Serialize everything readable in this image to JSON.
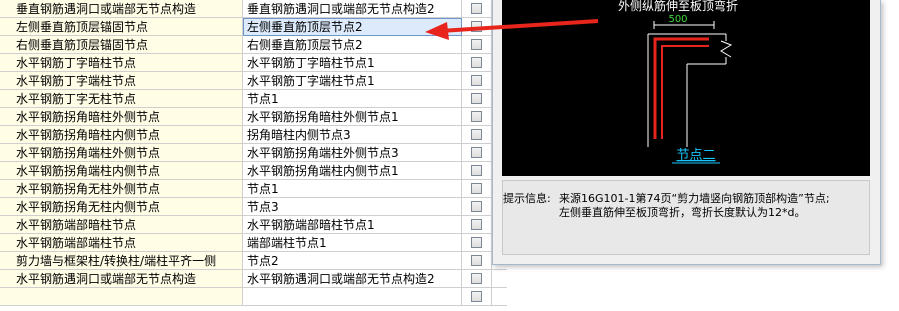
{
  "rows": [
    {
      "name": "垂直钢筋遇洞口或端部无节点构造",
      "value": "垂直钢筋遇洞口或端部无节点构造2"
    },
    {
      "name": "左侧垂直筋顶层锚固节点",
      "value": "左侧垂直筋顶层节点2"
    },
    {
      "name": "右侧垂直筋顶层锚固节点",
      "value": "右侧垂直筋顶层节点2"
    },
    {
      "name": "水平钢筋丁字暗柱节点",
      "value": "水平钢筋丁字暗柱节点1"
    },
    {
      "name": "水平钢筋丁字端柱节点",
      "value": "水平钢筋丁字端柱节点1"
    },
    {
      "name": "水平钢筋丁字无柱节点",
      "value": "节点1"
    },
    {
      "name": "水平钢筋拐角暗柱外侧节点",
      "value": "水平钢筋拐角暗柱外侧节点1"
    },
    {
      "name": "水平钢筋拐角暗柱内侧节点",
      "value": "拐角暗柱内侧节点3"
    },
    {
      "name": "水平钢筋拐角端柱外侧节点",
      "value": "水平钢筋拐角端柱外侧节点3"
    },
    {
      "name": "水平钢筋拐角端柱内侧节点",
      "value": "水平钢筋拐角端柱内侧节点1"
    },
    {
      "name": "水平钢筋拐角无柱外侧节点",
      "value": "节点1"
    },
    {
      "name": "水平钢筋拐角无柱内侧节点",
      "value": "节点3"
    },
    {
      "name": "水平钢筋端部暗柱节点",
      "value": "水平钢筋端部暗柱节点1"
    },
    {
      "name": "水平钢筋端部端柱节点",
      "value": "端部端柱节点1"
    },
    {
      "name": "剪力墙与框架柱/转换柱/端柱平齐一侧",
      "value": "节点2"
    },
    {
      "name": "水平钢筋遇洞口或端部无节点构造",
      "value": "水平钢筋遇洞口或端部无节点构造2"
    },
    {
      "name": "",
      "value": ""
    }
  ],
  "selected_row": 1,
  "preview": {
    "title": "外侧纵筋伸至板顶弯折",
    "dimension": "500",
    "caption": "节点二"
  },
  "info": {
    "label": "提示信息:",
    "line1": "来源16G101-1第74页“剪力墙竖向钢筋顶部构造”节点;",
    "line2": "左侧垂直筋伸至板顶弯折，弯折长度默认为12*d。"
  },
  "colors": {
    "name_column_bg": "#fffde6",
    "selected_bg": "#dceafb",
    "rebar": "#e8251c",
    "drawing_lines": "#ffffff",
    "dimension_text": "#3cd83c",
    "caption": "#17c7ff",
    "arrow": "#e8251c"
  }
}
